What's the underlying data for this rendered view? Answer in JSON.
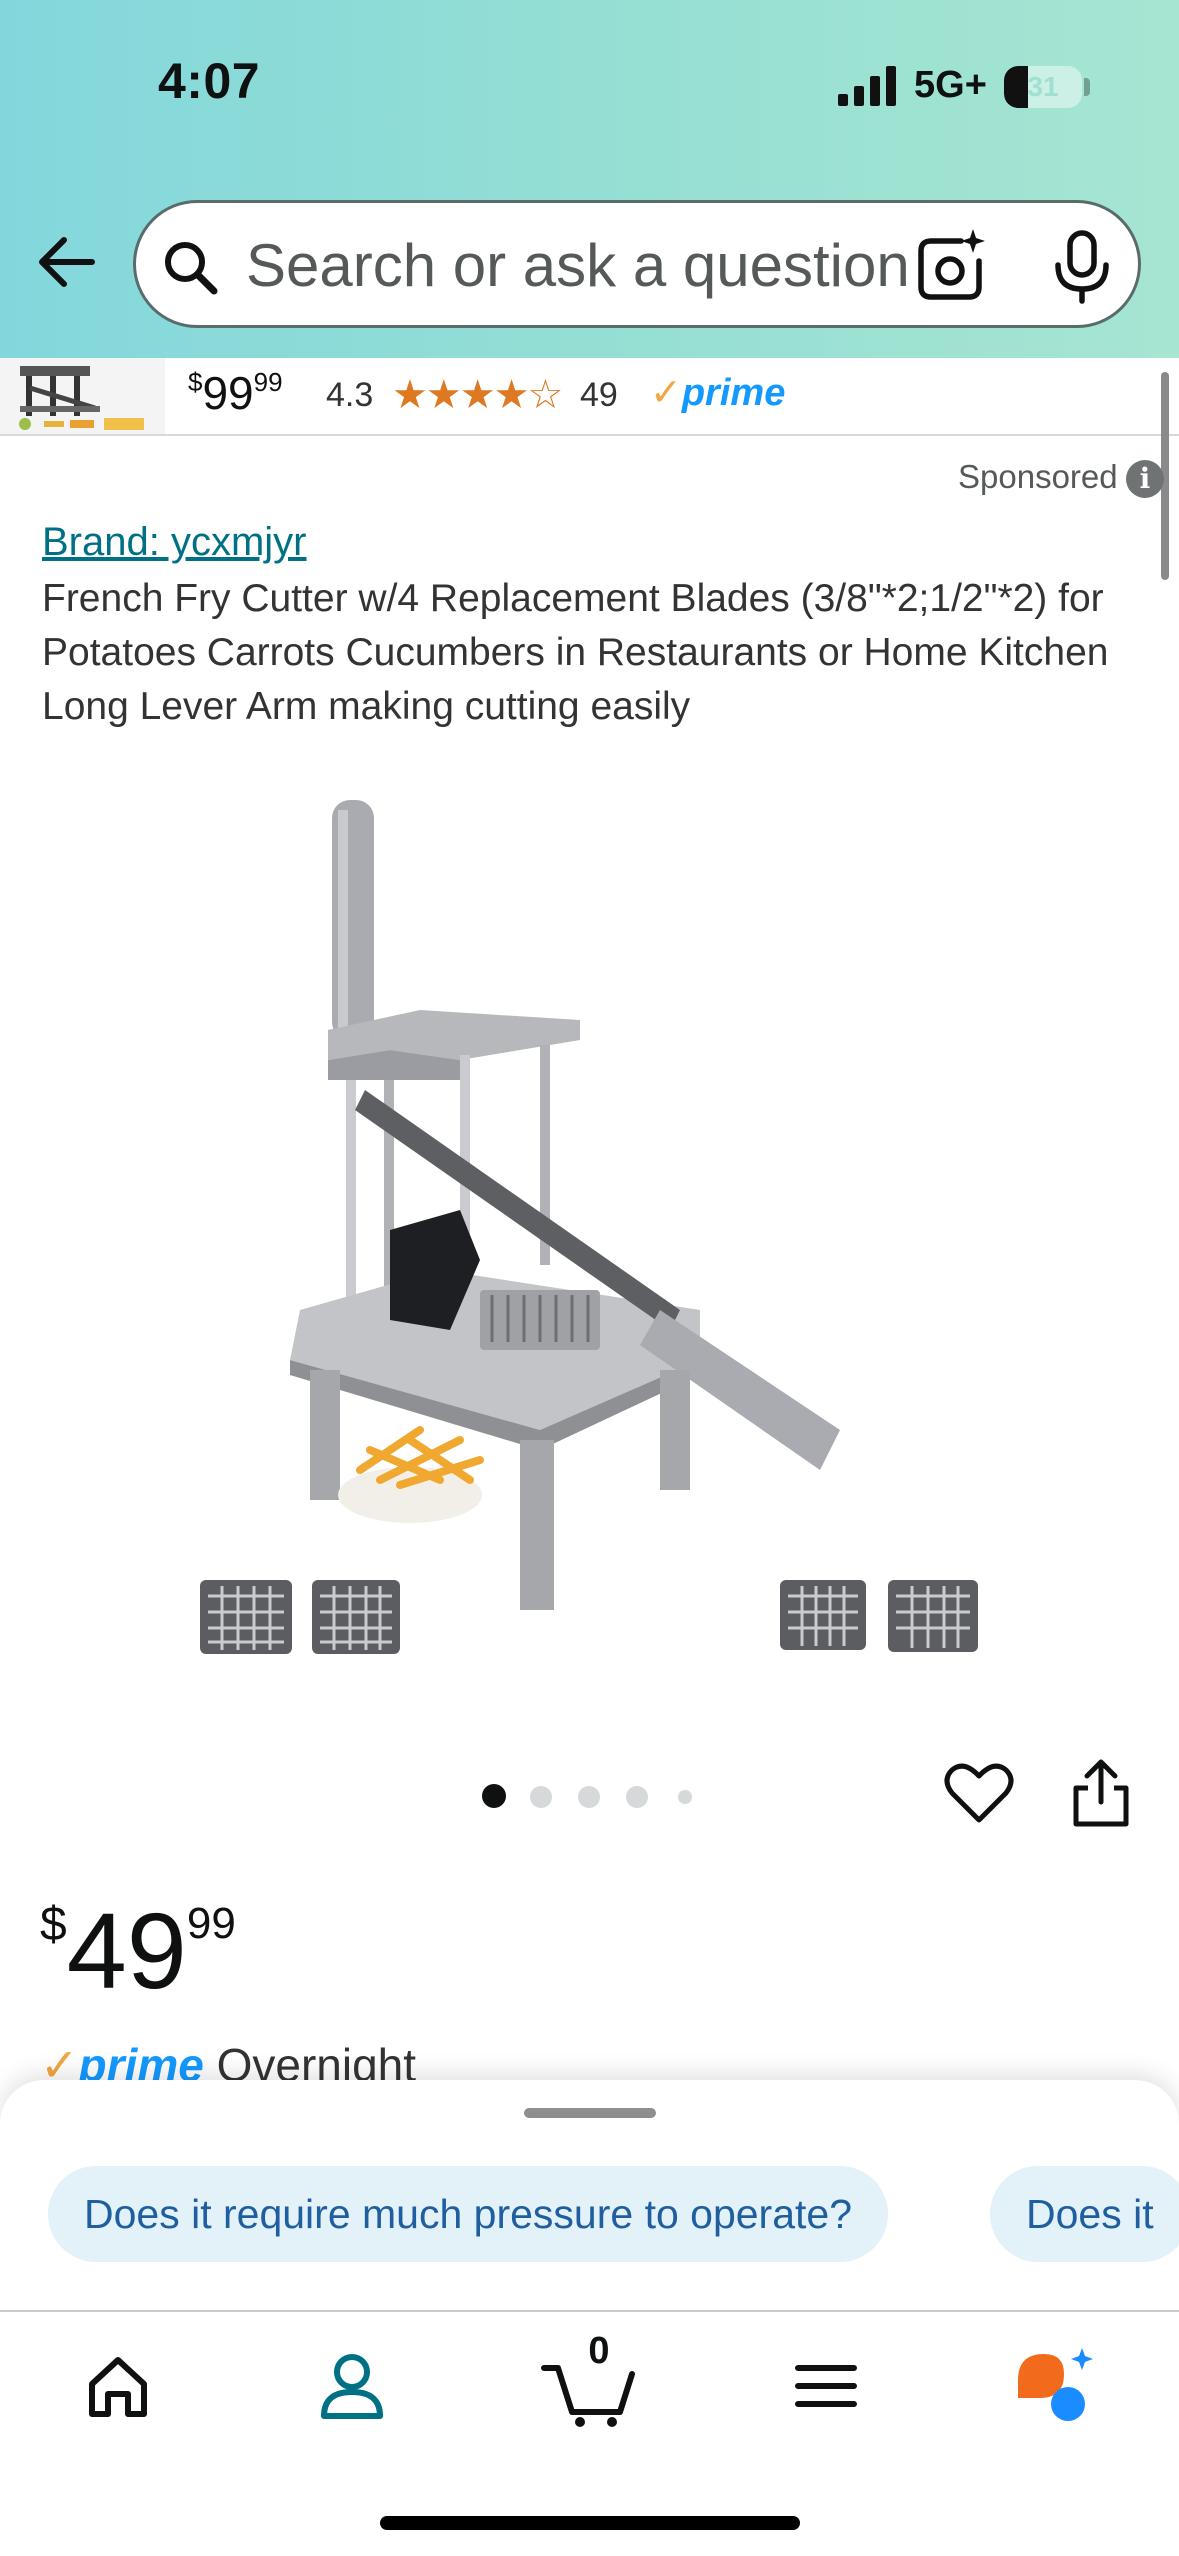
{
  "status_bar": {
    "time": "4:07",
    "network": "5G+",
    "battery": "31",
    "battery_level": 0.31
  },
  "search": {
    "placeholder": "Search or ask a question"
  },
  "sponsored_strip": {
    "price_whole": "99",
    "price_fraction": "99",
    "rating": "4.3",
    "stars": "★★★★☆",
    "review_count": "49",
    "prime_label": "prime"
  },
  "product": {
    "sponsored_label": "Sponsored",
    "brand": "Brand: ycxmjyr",
    "title": "French Fry Cutter w/4 Replacement Blades (3/8\"*2;1/2\"*2) for Potatoes Carrots Cucumbers in Restaurants or Home Kitchen Long Lever Arm making cutting easily",
    "image_count": 5,
    "current_image": 1,
    "price_symbol": "$",
    "price_whole": "49",
    "price_fraction": "99",
    "prime_label": "prime",
    "delivery": "Overnight"
  },
  "rufus": {
    "suggestions": [
      "Does it require much pressure to operate?",
      "Does it"
    ]
  },
  "bottom_nav": {
    "items": [
      {
        "name": "home",
        "icon": "home-icon"
      },
      {
        "name": "account",
        "icon": "person-icon"
      },
      {
        "name": "cart",
        "icon": "cart-icon",
        "count": "0"
      },
      {
        "name": "menu",
        "icon": "menu-icon"
      },
      {
        "name": "rufus",
        "icon": "rufus-chat-icon"
      }
    ]
  },
  "colors": {
    "accent_teal": "#007185",
    "prime_blue": "#1399ff",
    "star_orange": "#de7921",
    "chip_bg": "#e3f1f9"
  }
}
